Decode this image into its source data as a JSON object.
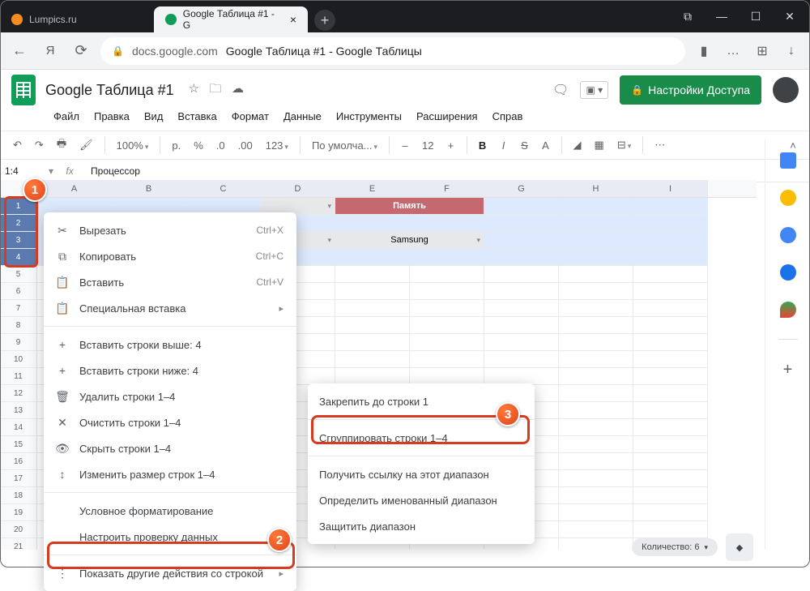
{
  "browser": {
    "tabs": [
      {
        "label": "Lumpics.ru",
        "active": false
      },
      {
        "label": "Google Таблица #1 - G",
        "active": true
      }
    ],
    "url_host": "docs.google.com",
    "url_title": "Google Таблица #1 - Google Таблицы"
  },
  "doc": {
    "name": "Google Таблица #1",
    "share_label": "Настройки Доступа"
  },
  "menubar": [
    "Файл",
    "Правка",
    "Вид",
    "Вставка",
    "Формат",
    "Данные",
    "Инструменты",
    "Расширения",
    "Справ"
  ],
  "toolbar": {
    "zoom": "100%",
    "currency": "p.",
    "percent": "%",
    "dec_dec": ".0",
    "dec_inc": ".00",
    "num": "123",
    "font": "По умолча...",
    "size": "12"
  },
  "namebox": "1:4",
  "fx": "Процессор",
  "columns": [
    "A",
    "B",
    "C",
    "D",
    "E",
    "F",
    "G",
    "H",
    "I"
  ],
  "sheet": {
    "header1_E": "Память",
    "header2_E": "Samsung"
  },
  "ctx1": {
    "cut": "Вырезать",
    "cut_sc": "Ctrl+X",
    "copy": "Копировать",
    "copy_sc": "Ctrl+C",
    "paste": "Вставить",
    "paste_sc": "Ctrl+V",
    "pastespecial": "Специальная вставка",
    "ins_above": "Вставить строки выше: 4",
    "ins_below": "Вставить строки ниже: 4",
    "del": "Удалить строки 1–4",
    "clear": "Очистить строки 1–4",
    "hide": "Скрыть строки 1–4",
    "resize": "Изменить размер строк 1–4",
    "cond": "Условное форматирование",
    "valid": "Настроить проверку данных",
    "more": "Показать другие действия со строкой"
  },
  "ctx2": {
    "freeze": "Закрепить до строки 1",
    "group": "Сгруппировать строки 1–4",
    "link": "Получить ссылку на этот диапазон",
    "named": "Определить именованный диапазон",
    "protect": "Защитить диапазон"
  },
  "status": {
    "count_label": "Количество: 6"
  },
  "badges": {
    "b1": "1",
    "b2": "2",
    "b3": "3"
  }
}
